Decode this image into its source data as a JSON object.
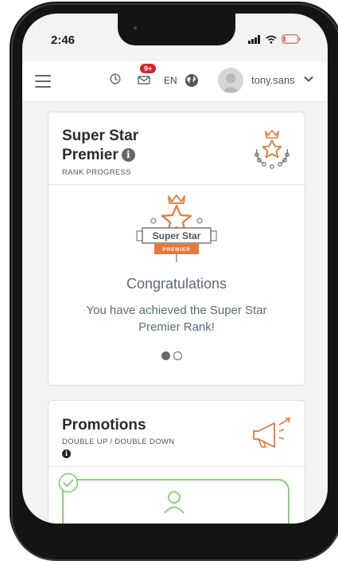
{
  "status_bar": {
    "time": "2:46"
  },
  "header": {
    "notification_count": "9+",
    "language": "EN",
    "username": "tony.sans"
  },
  "rank_card": {
    "title": "Super Star Premier",
    "subtitle": "RANK PROGRESS",
    "badge_text": "Super Star",
    "badge_ribbon": "PREMIER",
    "congrats": "Congratulations",
    "message": "You have achieved the Super Star Premier Rank!",
    "carousel": {
      "total": 2,
      "active": 1
    }
  },
  "promotions_card": {
    "title": "Promotions",
    "subtitle": "DOUBLE UP / DOUBLE DOWN",
    "info_glyph": "i"
  },
  "colors": {
    "accent_orange": "#e8763a",
    "offer_green": "#8bd17c",
    "badge_red": "#e0202a",
    "text_slate": "#5b6a7c"
  },
  "icons": [
    "hamburger-icon",
    "clock-icon",
    "mail-icon",
    "globe-icon",
    "user-avatar",
    "chevron-down-icon",
    "rank-star-icon",
    "megaphone-icon",
    "check-icon",
    "person-icon",
    "signal-icon",
    "wifi-icon",
    "battery-icon"
  ]
}
